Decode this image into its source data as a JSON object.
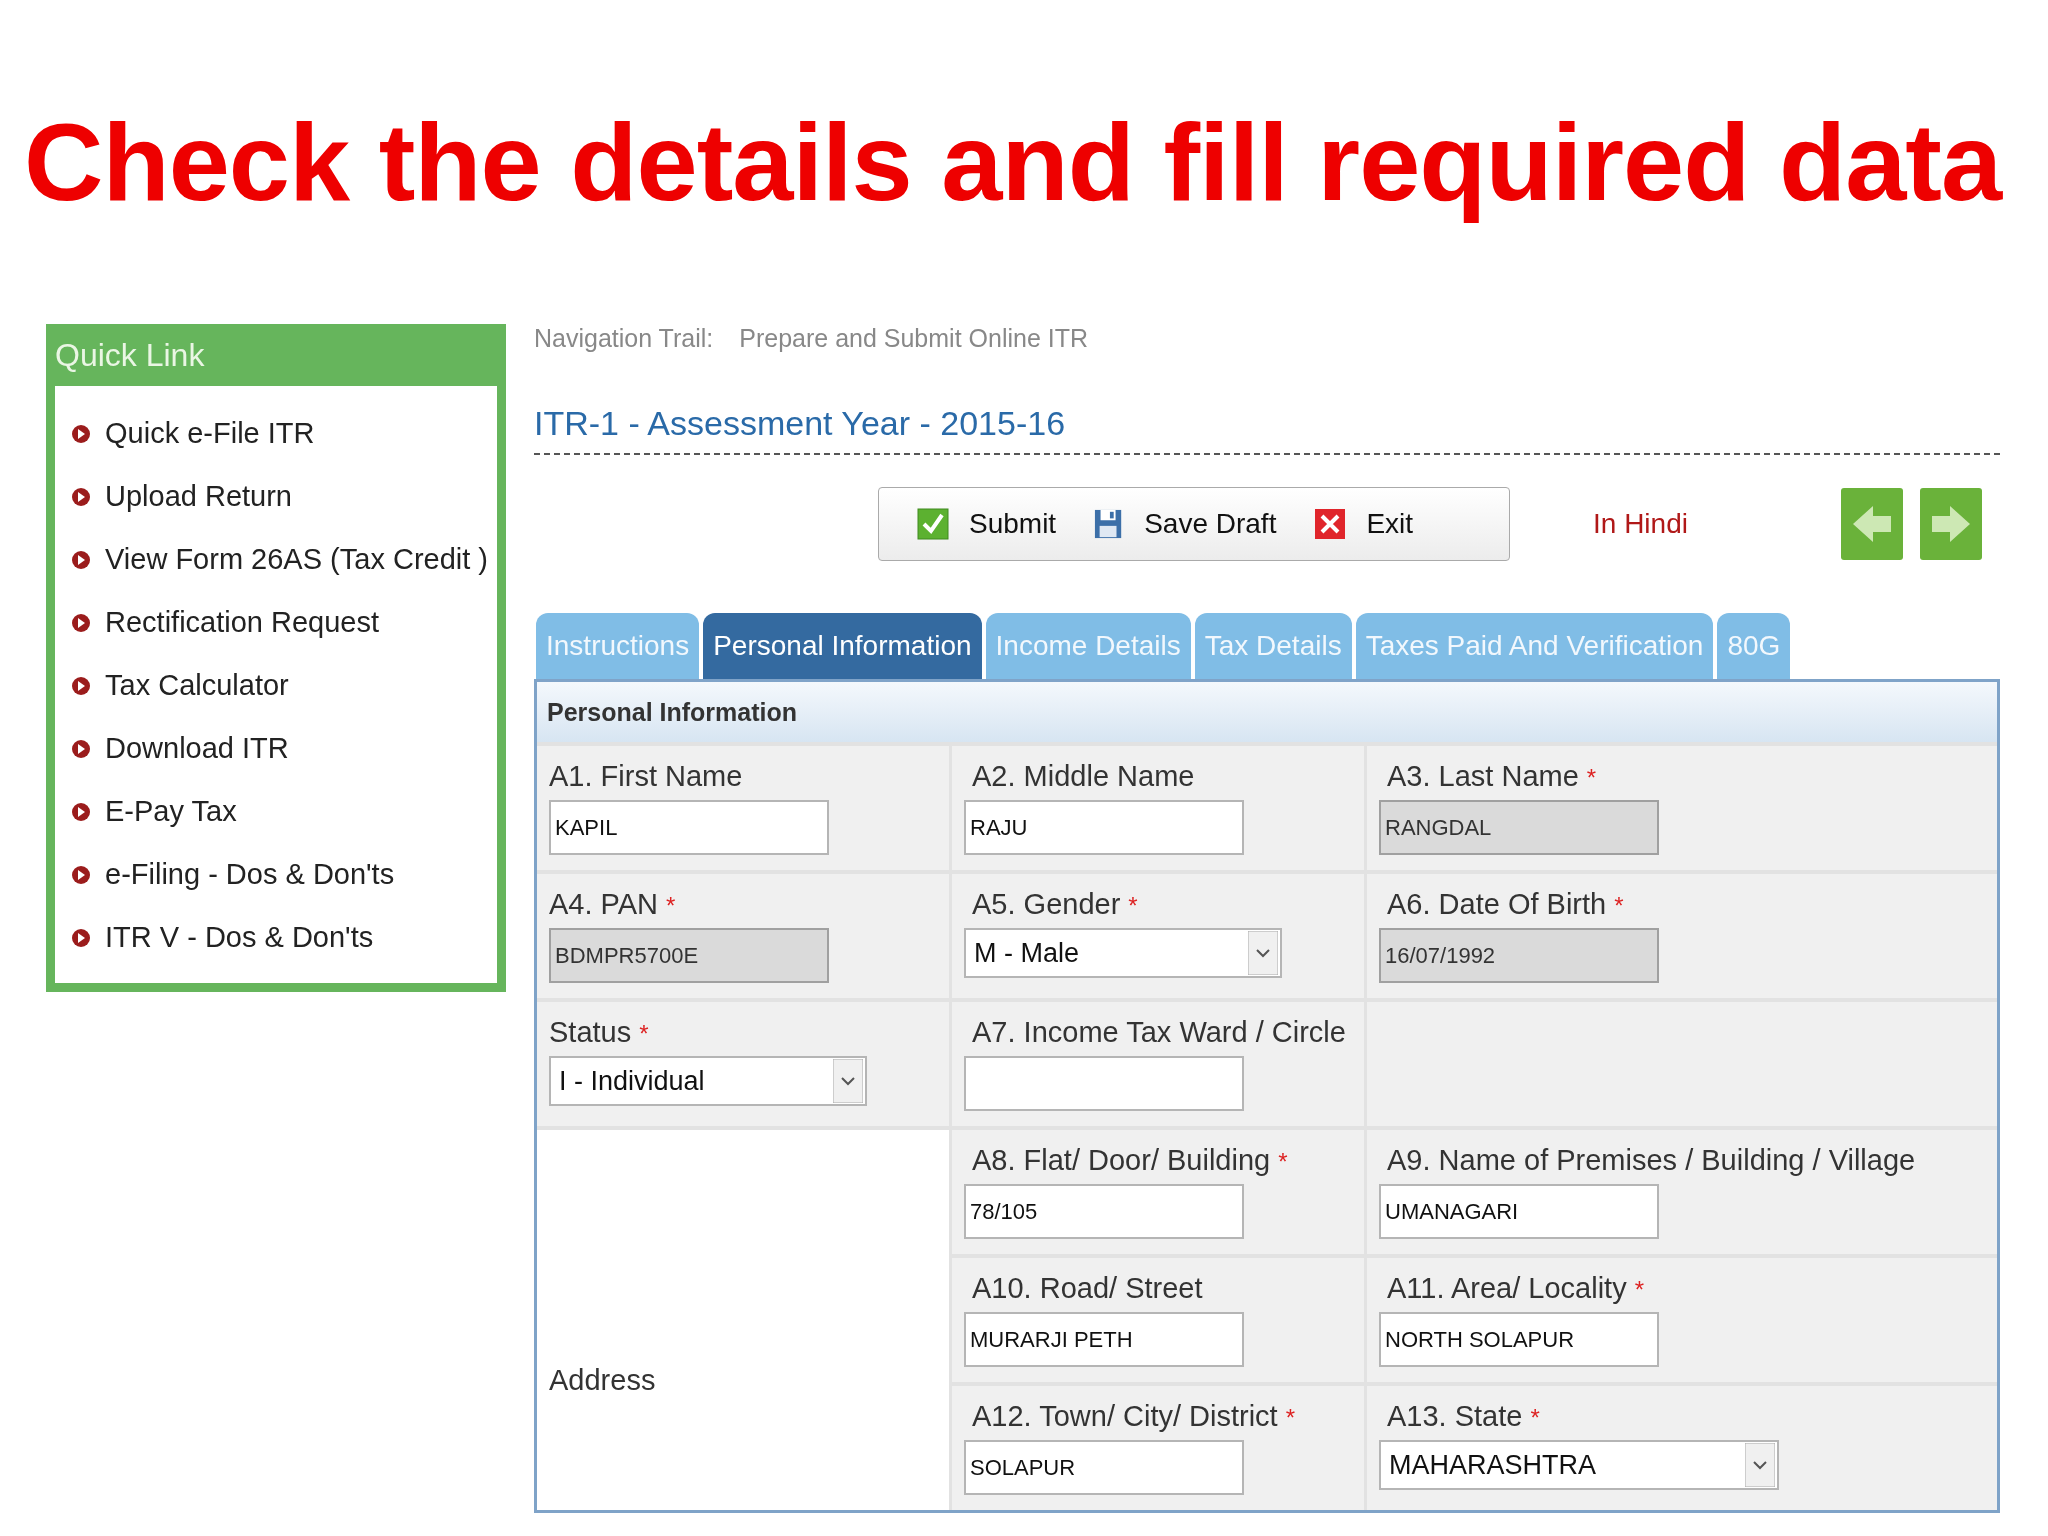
{
  "heading": "Check the details and fill required data",
  "quick_link": {
    "title": "Quick Link",
    "items": [
      "Quick e-File ITR",
      "Upload Return",
      "View Form 26AS (Tax Credit )",
      "Rectification Request",
      "Tax Calculator",
      "Download ITR",
      "E-Pay Tax",
      "e-Filing - Dos & Don'ts",
      "ITR V - Dos & Don'ts"
    ]
  },
  "navigation_trail": {
    "label": "Navigation Trail:",
    "value": "Prepare and Submit Online ITR"
  },
  "form_title": "ITR-1 - Assessment Year - 2015-16",
  "toolbar": [
    {
      "label": "Submit",
      "kind": "submit"
    },
    {
      "label": "Save Draft",
      "kind": "save"
    },
    {
      "label": "Exit",
      "kind": "exit"
    }
  ],
  "language_link": "In Hindi",
  "tabs": [
    {
      "label": "Instructions",
      "selected": false
    },
    {
      "label": "Personal Information",
      "selected": true
    },
    {
      "label": "Income Details",
      "selected": false
    },
    {
      "label": "Tax Details",
      "selected": false
    },
    {
      "label": "Taxes Paid And Verification",
      "selected": false
    },
    {
      "label": "80G",
      "selected": false
    }
  ],
  "section_title": "Personal Information",
  "rows": [
    [
      {
        "label": "A1. First Name",
        "kind": "text",
        "value": "KAPIL",
        "disabled": false
      },
      {
        "label": "A2. Middle Name",
        "kind": "text",
        "value": "RAJU",
        "disabled": false
      },
      {
        "label": "A3. Last Name",
        "required_mark": "*",
        "kind": "text",
        "value": "RANGDAL",
        "disabled": true
      }
    ],
    [
      {
        "label": "A4. PAN",
        "required_mark": "*",
        "kind": "text",
        "value": "BDMPR5700E",
        "disabled": true
      },
      {
        "label": "A5. Gender",
        "required_mark": "*",
        "kind": "select",
        "value": "M - Male"
      },
      {
        "label": "A6. Date Of Birth",
        "required_mark": "*",
        "kind": "text",
        "value": "16/07/1992",
        "disabled": true
      }
    ],
    [
      {
        "label": "Status",
        "required_mark": "*",
        "kind": "select",
        "value": "I - Individual"
      },
      {
        "label": "A7. Income Tax Ward / Circle",
        "kind": "text",
        "disabled": false
      }
    ]
  ],
  "address": {
    "label": "Address",
    "rows": [
      [
        {
          "label": "A8. Flat/ Door/ Building",
          "required_mark": "*",
          "kind": "text",
          "value": "78/105",
          "disabled": false
        },
        {
          "label": "A9. Name of Premises / Building / Village",
          "kind": "text",
          "value": "UMANAGARI",
          "disabled": false
        }
      ],
      [
        {
          "label": "A10. Road/ Street",
          "kind": "text",
          "value": "MURARJI PETH",
          "disabled": false
        },
        {
          "label": "A11. Area/ Locality",
          "required_mark": "*",
          "kind": "text",
          "value": "NORTH SOLAPUR",
          "disabled": false
        }
      ],
      [
        {
          "label": "A12. Town/ City/ District",
          "required_mark": "*",
          "kind": "text",
          "value": "SOLAPUR",
          "disabled": false
        },
        {
          "label": "A13. State",
          "required_mark": "*",
          "kind": "select",
          "value": "MAHARASHTRA"
        }
      ]
    ]
  }
}
